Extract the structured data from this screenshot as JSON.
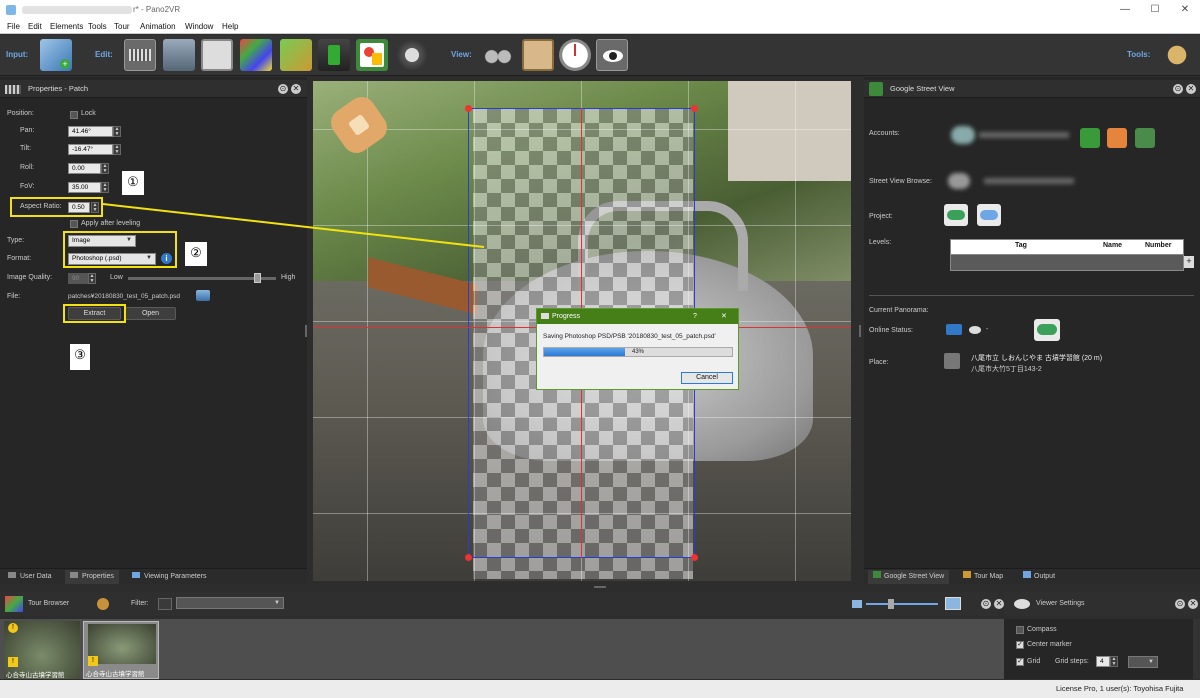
{
  "window": {
    "title": "r* - Pano2VR"
  },
  "menu": [
    "File",
    "Edit",
    "Elements",
    "Tools",
    "Tour",
    "Animation",
    "Window",
    "Help"
  ],
  "toolbar": {
    "input_label": "Input:",
    "edit_label": "Edit:",
    "view_label": "View:",
    "tools_label": "Tools:"
  },
  "properties": {
    "title": "Properties - Patch",
    "position_label": "Position:",
    "lock_label": "Lock",
    "pan_label": "Pan:",
    "pan_value": "41.46°",
    "tilt_label": "Tilt:",
    "tilt_value": "-16.47°",
    "roll_label": "Roll:",
    "roll_value": "0.00",
    "fov_label": "FoV:",
    "fov_value": "35.00",
    "aspect_label": "Aspect Ratio:",
    "aspect_value": "0.50",
    "apply_label": "Apply after leveling",
    "type_label": "Type:",
    "type_value": "Image",
    "format_label": "Format:",
    "format_value": "Photoshop (.psd)",
    "quality_label": "Image Quality:",
    "quality_value": "90",
    "low_label": "Low",
    "high_label": "High",
    "file_label": "File:",
    "file_value": "patches¥20180830_test_05_patch.psd",
    "extract_label": "Extract",
    "open_label": "Open"
  },
  "annotations": {
    "n1": "①",
    "n2": "②",
    "n3": "③"
  },
  "left_tabs": [
    "User Data",
    "Properties",
    "Viewing Parameters"
  ],
  "progress": {
    "title": "Progress",
    "help": "?",
    "close": "✕",
    "message": "Saving Photoshop PSD/PSB '20180830_test_05_patch.psd'",
    "percent": 0.43,
    "percent_text": "43%",
    "cancel": "Cancel"
  },
  "gsv": {
    "title": "Google Street View",
    "accounts_label": "Accounts:",
    "browse_label": "Street View Browse:",
    "project_label": "Project:",
    "levels_label": "Levels:",
    "columns": [
      "Tag",
      "Name",
      "Number"
    ],
    "current_label": "Current Panorama:",
    "online_label": "Online Status:",
    "online_value": "-",
    "place_label": "Place:",
    "place_line1": "八尾市立 しおんじやま 古墳学習館 (20 m)",
    "place_line2": "八尾市大竹5丁目143-2"
  },
  "right_tabs": [
    "Google Street View",
    "Tour Map",
    "Output"
  ],
  "tour": {
    "title": "Tour Browser",
    "filter_label": "Filter:",
    "thumb1": "心合寺山古墳学習館",
    "thumb2": "心合寺山古墳学習館"
  },
  "viewer_settings": {
    "title": "Viewer Settings",
    "compass": "Compass",
    "center_marker": "Center marker",
    "grid": "Grid",
    "grid_steps": "Grid steps:",
    "grid_steps_value": "4"
  },
  "status": {
    "text": "License Pro, 1 user(s): Toyohisa Fujita"
  },
  "colors": {
    "accent_blue": "#6ea7e3",
    "dialog_green": "#467f18",
    "annotation_yellow": "#f2e310",
    "progress_blue": "#2b7bd6"
  }
}
